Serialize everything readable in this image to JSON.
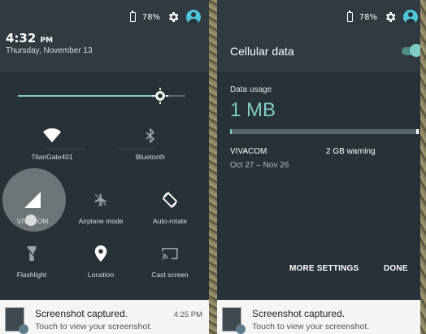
{
  "status": {
    "battery": "78%"
  },
  "left": {
    "time": "4:32",
    "ampm": "PM",
    "date": "Thursday, November 13",
    "brightness_level": 0.85,
    "tiles": [
      {
        "label": "TitanGate401",
        "icon": "wifi-icon"
      },
      {
        "label": "Bluetooth",
        "icon": "bluetooth-icon"
      },
      {
        "label": "VIVACOM",
        "icon": "cellular-signal-icon"
      },
      {
        "label": "Airplane mode",
        "icon": "airplane-icon"
      },
      {
        "label": "Auto-rotate",
        "icon": "auto-rotate-icon"
      },
      {
        "label": "Flashlight",
        "icon": "flashlight-icon"
      },
      {
        "label": "Location",
        "icon": "location-icon"
      },
      {
        "label": "Cast screen",
        "icon": "cast-icon"
      }
    ]
  },
  "notification": {
    "title": "Screenshot captured.",
    "subtitle": "Touch to view your screenshot.",
    "time": "4:25 PM"
  },
  "right": {
    "title": "Cellular data",
    "usage_label": "Data usage",
    "usage_value": "1 MB",
    "usage_fraction": 0.0005,
    "carrier": "VIVACOM",
    "warning": "2 GB warning",
    "range": "Oct 27 – Nov 26",
    "more_settings": "MORE SETTINGS",
    "done": "DONE"
  },
  "colors": {
    "accent": "#80cbc4",
    "panel": "#263238",
    "header": "#2f3b41"
  }
}
